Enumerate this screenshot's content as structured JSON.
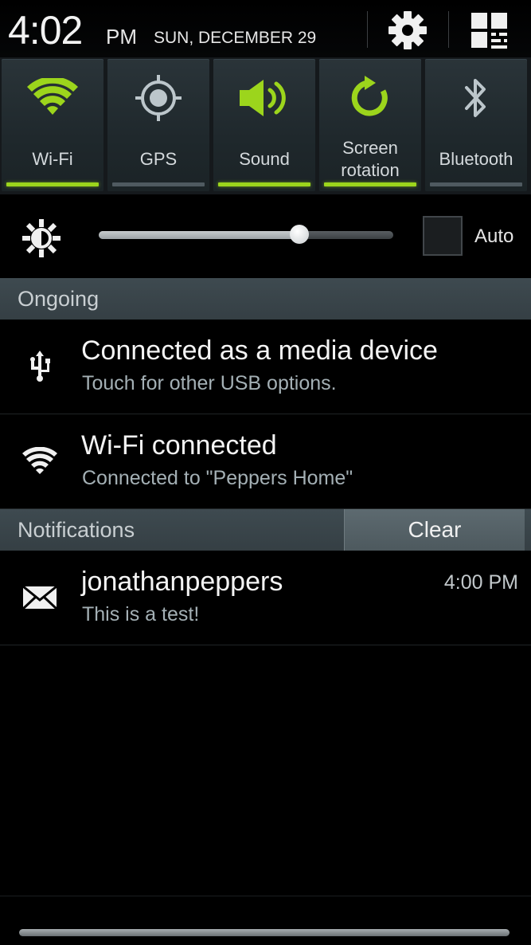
{
  "status": {
    "time": "4:02",
    "ampm": "PM",
    "date": "SUN, DECEMBER 29"
  },
  "header_buttons": [
    {
      "name": "settings",
      "icon": "gear-icon"
    },
    {
      "name": "quick-settings-panel",
      "icon": "grid-toggle-icon"
    }
  ],
  "toggles": [
    {
      "label": "Wi-Fi",
      "icon": "wifi-icon",
      "on": true
    },
    {
      "label": "GPS",
      "icon": "gps-icon",
      "on": false
    },
    {
      "label": "Sound",
      "icon": "sound-icon",
      "on": true
    },
    {
      "label": "Screen rotation",
      "icon": "rotation-icon",
      "on": true
    },
    {
      "label": "Bluetooth",
      "icon": "bluetooth-icon",
      "on": false
    }
  ],
  "brightness": {
    "level": 0.68,
    "auto_label": "Auto",
    "auto_checked": false
  },
  "ongoing": {
    "header": "Ongoing",
    "items": [
      {
        "icon": "usb-icon",
        "title": "Connected as a media device",
        "subtitle": "Touch for other USB options."
      },
      {
        "icon": "wifi-icon",
        "title": "Wi-Fi connected",
        "subtitle": "Connected to \"Peppers Home\""
      }
    ]
  },
  "notifications": {
    "header": "Notifications",
    "clear_label": "Clear",
    "items": [
      {
        "icon": "envelope-icon",
        "title": "jonathanpeppers",
        "subtitle": "This is a test!",
        "time": "4:00 PM"
      }
    ]
  },
  "colors": {
    "accent_on": "#9cd51c",
    "indicator_off": "#4f5a60",
    "section_header": "#3a454b",
    "subtitle_text": "#a4b0b5"
  }
}
